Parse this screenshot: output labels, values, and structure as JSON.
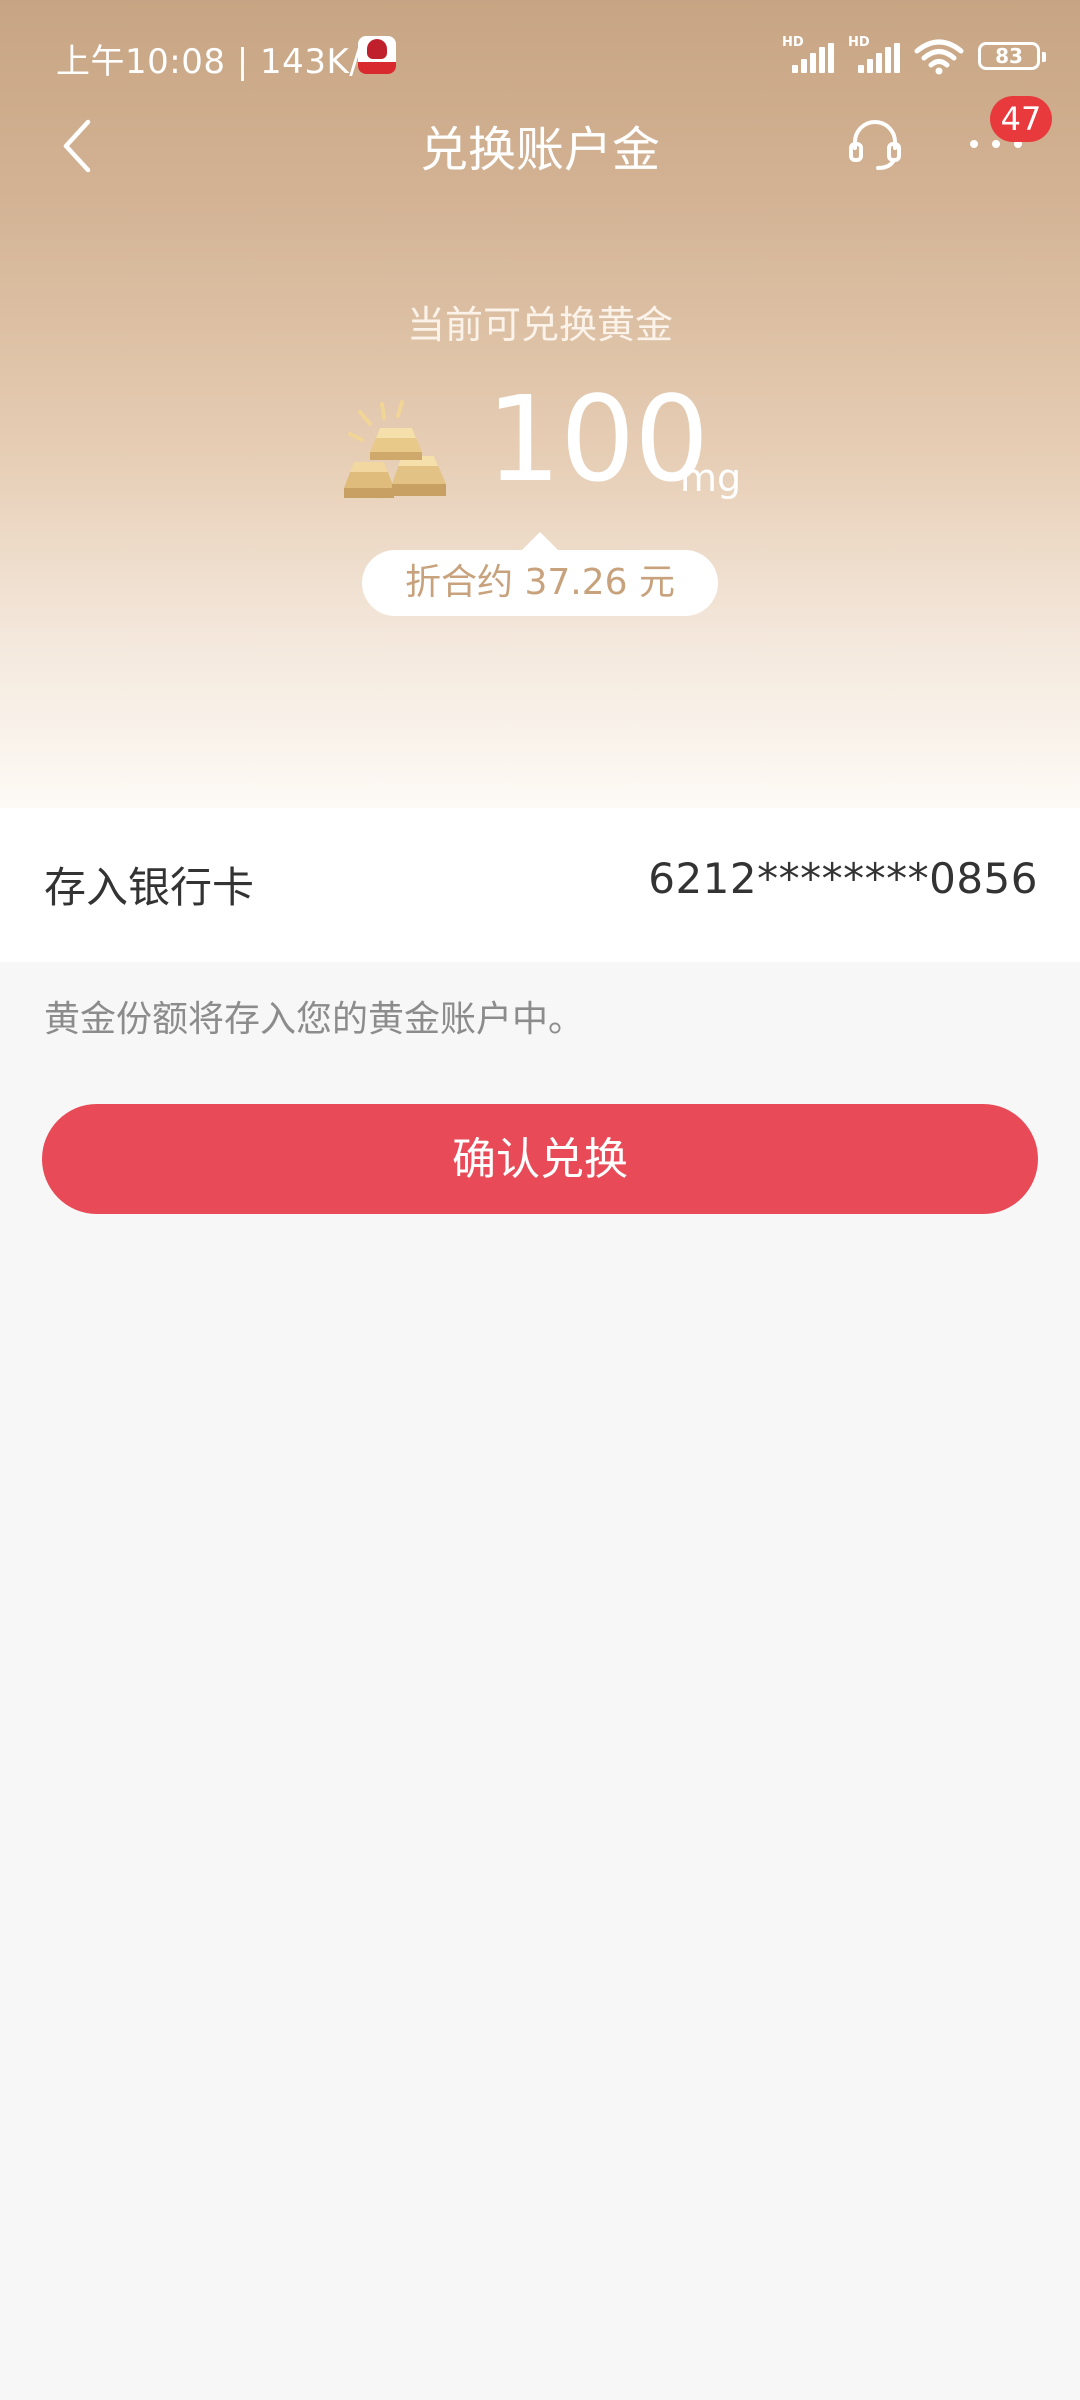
{
  "status_bar": {
    "time_speed": "上午10:08 | 143K/s",
    "battery": "83",
    "signal_label": "HD"
  },
  "nav": {
    "title": "兑换账户金",
    "badge_count": "47"
  },
  "gold": {
    "caption": "当前可兑换黄金",
    "amount": "100",
    "unit": "mg",
    "equivalent": "折合约 37.26 元"
  },
  "card": {
    "label": "存入银行卡",
    "number": "6212********0856"
  },
  "note": "黄金份额将存入您的黄金账户中。",
  "confirm_button": "确认兑换",
  "colors": {
    "hero_top": "#c7a584",
    "confirm": "#e84b57",
    "badge": "#e83a3d",
    "equiv_text": "#c7a27c"
  }
}
